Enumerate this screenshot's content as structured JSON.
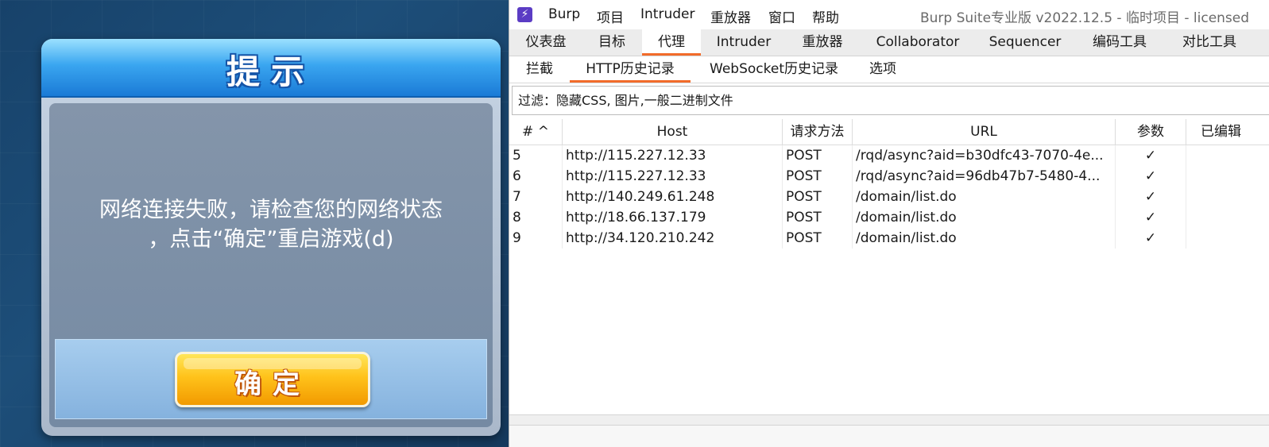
{
  "game_dialog": {
    "title": "提示",
    "message": "网络连接失败，请检查您的网络状态\n，点击“确定”重启游戏(d)",
    "confirm_label": "确定"
  },
  "burp": {
    "app_icon": "lightning-icon",
    "menu": [
      "Burp",
      "项目",
      "Intruder",
      "重放器",
      "窗口",
      "帮助"
    ],
    "window_title": "Burp Suite专业版  v2022.12.5 - 临时项目 - licensed",
    "main_tabs": [
      "仪表盘",
      "目标",
      "代理",
      "Intruder",
      "重放器",
      "Collaborator",
      "Sequencer",
      "编码工具",
      "对比工具"
    ],
    "main_tab_active": "代理",
    "proxy_tabs": [
      "拦截",
      "HTTP历史记录",
      "WebSocket历史记录",
      "选项"
    ],
    "proxy_tab_active": "HTTP历史记录",
    "filter": "过滤：隐藏CSS, 图片,一般二进制文件",
    "columns": [
      "# ^",
      "Host",
      "请求方法",
      "URL",
      "参数",
      "已编辑"
    ],
    "rows": [
      {
        "num": "5",
        "host": "http://115.227.12.33",
        "method": "POST",
        "url": "/rqd/async?aid=b30dfc43-7070-4e...",
        "params": "✓",
        "edited": ""
      },
      {
        "num": "6",
        "host": "http://115.227.12.33",
        "method": "POST",
        "url": "/rqd/async?aid=96db47b7-5480-4...",
        "params": "✓",
        "edited": ""
      },
      {
        "num": "7",
        "host": "http://140.249.61.248",
        "method": "POST",
        "url": "/domain/list.do",
        "params": "✓",
        "edited": ""
      },
      {
        "num": "8",
        "host": "http://18.66.137.179",
        "method": "POST",
        "url": "/domain/list.do",
        "params": "✓",
        "edited": ""
      },
      {
        "num": "9",
        "host": "http://34.120.210.242",
        "method": "POST",
        "url": "/domain/list.do",
        "params": "✓",
        "edited": ""
      }
    ],
    "accent_color": "#f26b2a"
  }
}
